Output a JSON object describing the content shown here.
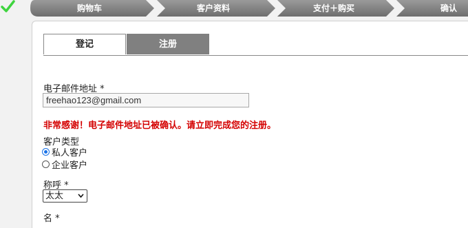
{
  "steps": [
    {
      "label": "购物车",
      "done": true
    },
    {
      "label": "客户资料",
      "done": false
    },
    {
      "label": "支付＋购买",
      "done": false
    },
    {
      "label": "确认",
      "done": false
    }
  ],
  "tabs": [
    {
      "label": "登记",
      "active": false
    },
    {
      "label": "注册",
      "active": true
    }
  ],
  "form": {
    "email_label": "电子邮件地址 *",
    "email_value": "freehao123@gmail.com",
    "success_message": "非常感谢！电子邮件地址已被确认。请立即完成您的注册。",
    "customer_type_label": "客户类型",
    "customer_types": [
      {
        "label": "私人客户",
        "checked": true
      },
      {
        "label": "企业客户",
        "checked": false
      }
    ],
    "salutation_label": "称呼 *",
    "salutation_value": "太太",
    "name_label": "名 *"
  },
  "colors": {
    "step_bar": "#7a7a7a",
    "accent_check": "#33cc33",
    "error_red": "#d40000",
    "tab_active": "#808080"
  }
}
